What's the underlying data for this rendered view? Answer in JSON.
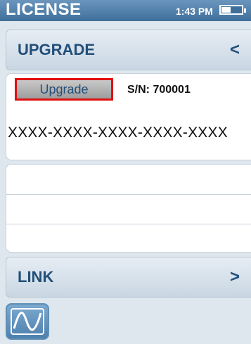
{
  "status_bar": {
    "title": "LICENSE",
    "time": "1:43 PM"
  },
  "upgrade_section": {
    "title": "UPGRADE",
    "arrow": "<",
    "button_label": "Upgrade",
    "serial": "S/N: 700001",
    "key": "XXXX-XXXX-XXXX-XXXX-XXXX"
  },
  "link_section": {
    "title": "LINK",
    "arrow": ">"
  },
  "icons": {
    "battery": "battery-icon",
    "app_button": "graph-icon"
  }
}
